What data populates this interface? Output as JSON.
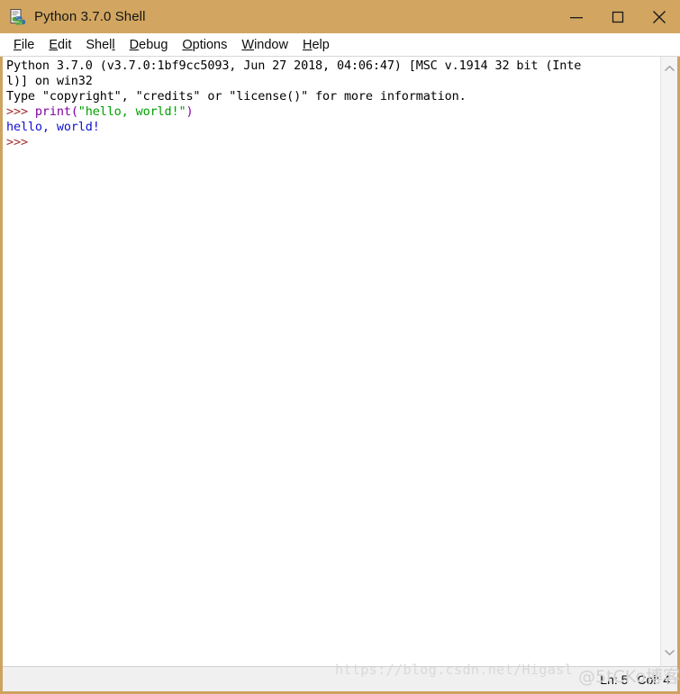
{
  "window": {
    "title": "Python 3.7.0 Shell",
    "icon": "python-file-icon",
    "titlebar_color": "#d2a661",
    "border_color": "#cda35f",
    "controls": {
      "minimize": "minimize-icon",
      "maximize": "maximize-icon",
      "close": "close-icon"
    }
  },
  "menubar": {
    "items": [
      {
        "label": "File",
        "mnemonic": "F",
        "before": "",
        "after": "ile"
      },
      {
        "label": "Edit",
        "mnemonic": "E",
        "before": "",
        "after": "dit"
      },
      {
        "label": "Shell",
        "mnemonic": "l",
        "before": "Shel",
        "after": ""
      },
      {
        "label": "Debug",
        "mnemonic": "D",
        "before": "",
        "after": "ebug"
      },
      {
        "label": "Options",
        "mnemonic": "O",
        "before": "",
        "after": "ptions"
      },
      {
        "label": "Window",
        "mnemonic": "W",
        "before": "",
        "after": "indow"
      },
      {
        "label": "Help",
        "mnemonic": "H",
        "before": "",
        "after": "elp"
      }
    ]
  },
  "shell": {
    "banner_line1": "Python 3.7.0 (v3.7.0:1bf9cc5093, Jun 27 2018, 04:06:47) [MSC v.1914 32 bit (Inte",
    "banner_line2": "l)] on win32",
    "banner_line3": "Type \"copyright\", \"credits\" or \"license()\" for more information.",
    "prompt": ">>> ",
    "command": {
      "keyword": "print",
      "open_paren": "(",
      "string": "\"hello, world!\"",
      "close_paren": ")"
    },
    "output": "hello, world!",
    "trailing_prompt": ">>> ",
    "colors": {
      "prompt": "#a03030",
      "keyword": "#8000a0",
      "string": "#00a000",
      "stdout": "#1010cf",
      "normal": "#000000"
    }
  },
  "scrollbar": {
    "up_arrow": "chevron-up-icon",
    "down_arrow": "chevron-down-icon"
  },
  "statusbar": {
    "line": "Ln: 5",
    "column": "Col: 4"
  },
  "watermark": {
    "url": "https://blog.csdn.net/Higasl",
    "logo": "@5tCKo博客"
  }
}
